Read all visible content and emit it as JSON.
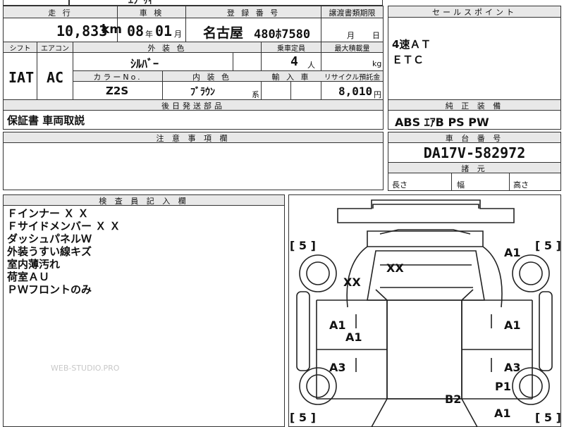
{
  "top_strip": {
    "model_partial": "ｴﾌﾞﾘｨ"
  },
  "header_labels": {
    "mileage": "走 行",
    "inspection": "車 検",
    "registration": "登 録 番 号",
    "transfer_deadline": "譲渡書類期限",
    "sales_point": "セールスポイント",
    "shift": "シフト",
    "aircon": "エアコン",
    "exterior_color": "外 装 色",
    "capacity": "乗車定員",
    "max_load": "最大積載量",
    "color_no": "カラーNo.",
    "interior_color": "内 装 色",
    "import": "輸 入 車",
    "recycle": "リサイクル預託金",
    "shipping_parts": "後日発送部品",
    "genuine_equipment": "純 正 装 備",
    "caution": "注 意 事 項 欄",
    "chassis_number": "車 台 番 号",
    "dimensions": "諸 元",
    "inspector_notes": "検 査 員 記 入 欄"
  },
  "values": {
    "mileage": "10,833",
    "mileage_unit": "km",
    "inspection_year": "08",
    "year_unit": "年",
    "inspection_month": "01",
    "month_unit": "月",
    "plate_region": "名古屋",
    "plate_number": "480ﾎ7580",
    "deadline_month_unit": "月",
    "deadline_day_unit": "日",
    "shift": "IAT",
    "aircon": "AC",
    "exterior_color": "ｼﾙﾊﾞｰ",
    "capacity": "4",
    "capacity_unit": "人",
    "max_load_unit": "kg",
    "color_no": "Z2S",
    "interior_color": "ﾌﾞﾗｳﾝ",
    "interior_suffix": "系",
    "recycle_fee": "8,010",
    "yen_unit": "円",
    "shipping_parts": "保証書 車両取説",
    "genuine_equipment": "ABS ｴｱB PS PW",
    "chassis_number": "DA17V-582972",
    "length_label": "長さ",
    "width_label": "幅",
    "height_label": "高さ"
  },
  "sales_points": [
    "4速ＡＴ",
    "ＥＴＣ"
  ],
  "inspector_notes": [
    "Ｆインナー Ｘ Ｘ",
    "Ｆサイドメンバー Ｘ Ｘ",
    "ダッシュパネルＷ",
    "外装うすい線キズ",
    "室内薄汚れ",
    "荷室ＡＵ",
    "ＰＷフロントのみ"
  ],
  "watermark": "WEB-STUDIO.PRO",
  "diagram": {
    "marks": [
      "[ 5 ]",
      "[ 5 ]",
      "[ 5 ]",
      "[ 5 ]",
      "A1",
      "XX",
      "XX",
      "A1",
      "A1",
      "A1",
      "A1",
      "A3",
      "A3",
      "P1",
      "B2",
      "A1"
    ]
  }
}
